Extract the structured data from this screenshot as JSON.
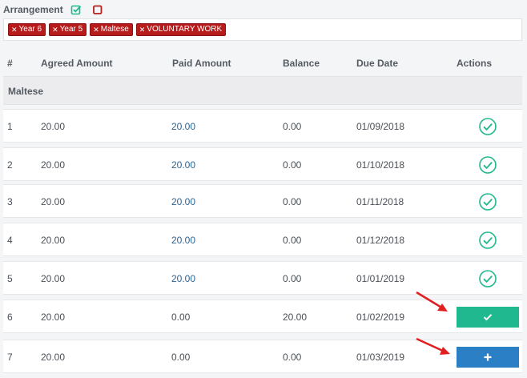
{
  "arrangement": {
    "label": "Arrangement",
    "select_all_icon": "check-square-icon",
    "clear_icon": "square-icon"
  },
  "tags": [
    {
      "label": "Year 6"
    },
    {
      "label": "Year 5"
    },
    {
      "label": "Maltese"
    },
    {
      "label": "VOLUNTARY WORK"
    }
  ],
  "table": {
    "columns": {
      "index": "#",
      "agreed": "Agreed Amount",
      "paid": "Paid Amount",
      "balance": "Balance",
      "due": "Due Date",
      "actions": "Actions"
    },
    "group_label": "Maltese",
    "rows": [
      {
        "index": "1",
        "agreed": "20.00",
        "paid": "20.00",
        "balance": "0.00",
        "due": "01/09/2018",
        "action": "paid-check-icon"
      },
      {
        "index": "2",
        "agreed": "20.00",
        "paid": "20.00",
        "balance": "0.00",
        "due": "01/10/2018",
        "action": "paid-check-icon"
      },
      {
        "index": "3",
        "agreed": "20.00",
        "paid": "20.00",
        "balance": "0.00",
        "due": "01/11/2018",
        "action": "paid-check-icon"
      },
      {
        "index": "4",
        "agreed": "20.00",
        "paid": "20.00",
        "balance": "0.00",
        "due": "01/12/2018",
        "action": "paid-check-icon"
      },
      {
        "index": "5",
        "agreed": "20.00",
        "paid": "20.00",
        "balance": "0.00",
        "due": "01/01/2019",
        "action": "paid-check-icon"
      },
      {
        "index": "6",
        "agreed": "20.00",
        "paid": "0.00",
        "balance": "20.00",
        "due": "01/02/2019",
        "action": "mark-paid-button"
      },
      {
        "index": "7",
        "agreed": "20.00",
        "paid": "0.00",
        "balance": "0.00",
        "due": "01/03/2019",
        "action": "add-payment-button"
      }
    ]
  },
  "colors": {
    "tag": "#b71c1c",
    "success": "#1fb88f",
    "primary": "#2b7fc4",
    "link": "#2a6496",
    "annotation_arrow": "#e02020"
  }
}
